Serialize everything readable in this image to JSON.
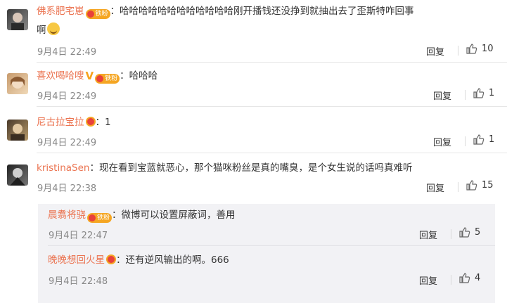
{
  "comments": [
    {
      "username": "佛系肥宅崽",
      "badge": "铁粉",
      "text_line1": "哈哈哈哈哈哈哈哈哈哈哈哈刚开播钱还没挣到就抽出去了歪斯特咋回事",
      "text_line2": "啊",
      "emoji": "laugh-cry-emoji",
      "time": "9月4日 22:49",
      "reply": "回复",
      "likes": "10"
    },
    {
      "username": "喜欢喝哈嗖",
      "badge": "铁粉",
      "text_line1": "哈哈哈",
      "time": "9月4日 22:49",
      "reply": "回复",
      "likes": "1"
    },
    {
      "username": "尼古拉宝拉",
      "text_line1": "1",
      "time": "9月4日 22:49",
      "reply": "回复",
      "likes": "1"
    },
    {
      "username": "kristinaSen",
      "text_line1": "现在看到宝蓝就恶心，那个猫咪粉丝是真的嘴臭，是个女生说的话吗真难听",
      "time": "9月4日 22:38",
      "reply": "回复",
      "likes": "15"
    }
  ],
  "replies": [
    {
      "username": "晨翥将骁",
      "badge": "铁粉",
      "text": "微博可以设置屏蔽词，善用",
      "time": "9月4日 22:47",
      "reply": "回复",
      "likes": "5"
    },
    {
      "username": "晚晚想回火星",
      "text": "还有逆风输出的啊。666",
      "time": "9月4日 22:48",
      "reply": "回复",
      "likes": "4"
    }
  ],
  "colors": {
    "username": "#eb7350",
    "time": "#888888",
    "fan_badge": "#f5a623"
  }
}
